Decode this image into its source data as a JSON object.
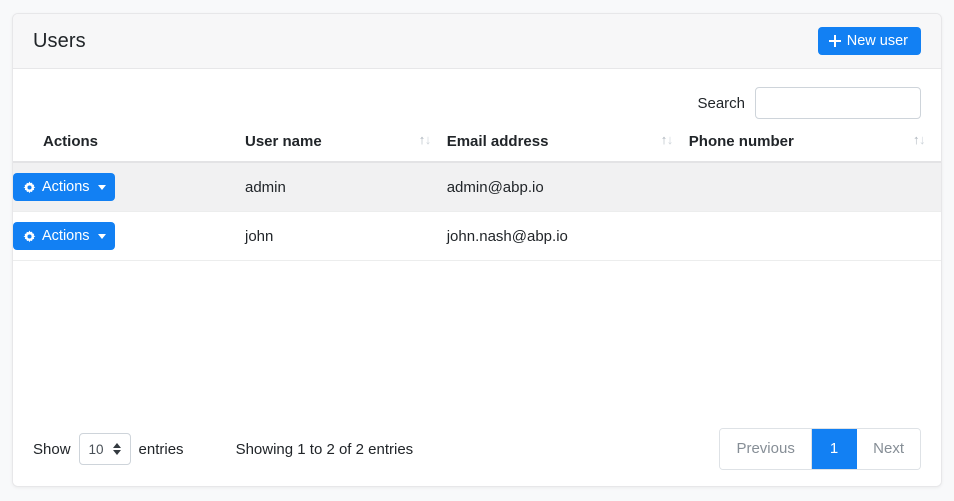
{
  "page": {
    "background_color": "#f8f9fa",
    "accent_color": "#1280f3"
  },
  "header": {
    "title": "Users",
    "new_user_label": "New user",
    "new_user_icon": "plus-icon"
  },
  "search": {
    "label": "Search",
    "value": "",
    "placeholder": ""
  },
  "table": {
    "columns": [
      {
        "label": "Actions",
        "sortable": false
      },
      {
        "label": "User name",
        "sortable": true,
        "sort_icon": "sort-updown-icon"
      },
      {
        "label": "Email address",
        "sortable": true,
        "sort_icon": "sort-updown-icon"
      },
      {
        "label": "Phone number",
        "sortable": true,
        "sort_icon": "sort-updown-icon"
      }
    ],
    "action_button_label": "Actions",
    "action_button_icon": "gear-icon",
    "rows": [
      {
        "actions": "Actions",
        "username": "admin",
        "email": "admin@abp.io",
        "phone": ""
      },
      {
        "actions": "Actions",
        "username": "john",
        "email": "john.nash@abp.io",
        "phone": ""
      }
    ]
  },
  "footer": {
    "show_label": "Show",
    "entries_label": "entries",
    "page_length": "10",
    "showing_info": "Showing 1 to 2 of 2 entries",
    "pagination": {
      "previous_label": "Previous",
      "page_1_label": "1",
      "next_label": "Next"
    }
  }
}
